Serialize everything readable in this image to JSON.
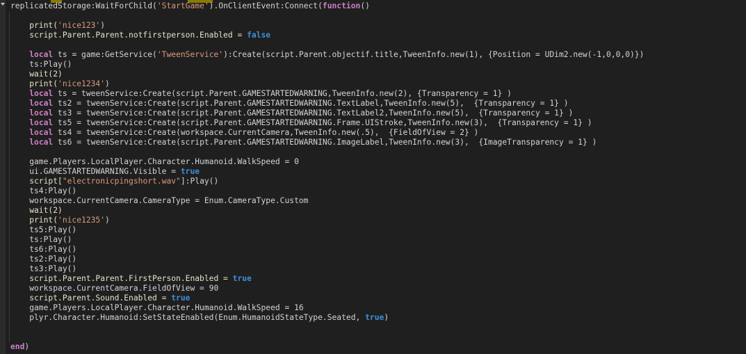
{
  "editor": {
    "colors": {
      "background": "#1f1f1f",
      "keyword": "#cc7fc7",
      "boolean": "#3d8fd6",
      "string": "#d99a7a",
      "text": "#d4d4d4"
    },
    "fold_icon": "chevron-down-icon",
    "lines": [
      [
        [
          "replicatedStorage:WaitForChild(",
          "p"
        ],
        [
          "'StartGame'",
          "s"
        ],
        [
          ").OnClientEvent:Connect(",
          "p"
        ],
        [
          "function",
          "k"
        ],
        [
          "()",
          "p"
        ]
      ],
      [],
      [
        [
          "    print(",
          "g"
        ],
        [
          "'nice123'",
          "s"
        ],
        [
          ")",
          "p"
        ]
      ],
      [
        [
          "    script.Parent.Parent.notfirstperson.Enabled = ",
          "g"
        ],
        [
          "false",
          "b"
        ]
      ],
      [],
      [
        [
          "    ",
          "p"
        ],
        [
          "local",
          "k"
        ],
        [
          " ts = game:GetService(",
          "p"
        ],
        [
          "'TweenService'",
          "s"
        ],
        [
          "):Create(script.Parent.objectif.title,TweenInfo.new(1), {Position = UDim2.new(-1,0,0,0)})",
          "p"
        ]
      ],
      [
        [
          "    ts:Play()",
          "p"
        ]
      ],
      [
        [
          "    wait(2)",
          "g"
        ]
      ],
      [
        [
          "    print(",
          "g"
        ],
        [
          "'nice1234'",
          "s"
        ],
        [
          ")",
          "p"
        ]
      ],
      [
        [
          "    ",
          "p"
        ],
        [
          "local",
          "k"
        ],
        [
          " ts = tweenService:Create(script.Parent.GAMESTARTEDWARNING,TweenInfo.new(2), {Transparency = 1} )",
          "p"
        ]
      ],
      [
        [
          "    ",
          "p"
        ],
        [
          "local",
          "k"
        ],
        [
          " ts2 = tweenService:Create(script.Parent.GAMESTARTEDWARNING.TextLabel,TweenInfo.new(5),  {Transparency = 1} )",
          "p"
        ]
      ],
      [
        [
          "    ",
          "p"
        ],
        [
          "local",
          "k"
        ],
        [
          " ts3 = tweenService:Create(script.Parent.GAMESTARTEDWARNING.TextLabel2,TweenInfo.new(5),  {Transparency = 1} )",
          "p"
        ]
      ],
      [
        [
          "    ",
          "p"
        ],
        [
          "local",
          "k"
        ],
        [
          " ts5 = tweenService:Create(script.Parent.GAMESTARTEDWARNING.Frame.UIStroke,TweenInfo.new(3),  {Transparency = 1} )",
          "p"
        ]
      ],
      [
        [
          "    ",
          "p"
        ],
        [
          "local",
          "k"
        ],
        [
          " ts4 = tweenService:Create(workspace.CurrentCamera,TweenInfo.new(.5),  {FieldOfView = 2} )",
          "p"
        ]
      ],
      [
        [
          "    ",
          "p"
        ],
        [
          "local",
          "k"
        ],
        [
          " ts6 = tweenService:Create(script.Parent.GAMESTARTEDWARNING.ImageLabel,TweenInfo.new(3),  {ImageTransparency = 1} )",
          "p"
        ]
      ],
      [],
      [
        [
          "    game.Players.LocalPlayer.Character.Humanoid.WalkSpeed = 0",
          "p"
        ]
      ],
      [
        [
          "    ui.GAMESTARTEDWARNING.Visible = ",
          "p"
        ],
        [
          "true",
          "b"
        ]
      ],
      [
        [
          "    script[",
          "g"
        ],
        [
          "\"electronicpingshort.wav\"",
          "s"
        ],
        [
          "]:Play()",
          "p"
        ]
      ],
      [
        [
          "    ts4:Play()",
          "p"
        ]
      ],
      [
        [
          "    workspace.CurrentCamera.CameraType = Enum.CameraType.Custom",
          "p"
        ]
      ],
      [
        [
          "    wait(2)",
          "g"
        ]
      ],
      [
        [
          "    print(",
          "g"
        ],
        [
          "'nice1235'",
          "s"
        ],
        [
          ")",
          "p"
        ]
      ],
      [
        [
          "    ts5:Play()",
          "p"
        ]
      ],
      [
        [
          "    ts:Play()",
          "p"
        ]
      ],
      [
        [
          "    ts6:Play()",
          "p"
        ]
      ],
      [
        [
          "    ts2:Play()",
          "p"
        ]
      ],
      [
        [
          "    ts3:Play()",
          "p"
        ]
      ],
      [
        [
          "    script.Parent.Parent.FirstPerson.Enabled = ",
          "g"
        ],
        [
          "true",
          "b"
        ]
      ],
      [
        [
          "    workspace.CurrentCamera.FieldOfView = 90",
          "p"
        ]
      ],
      [
        [
          "    script.Parent.Sound.Enabled = ",
          "g"
        ],
        [
          "true",
          "b"
        ]
      ],
      [
        [
          "    game.Players.LocalPlayer.Character.Humanoid.WalkSpeed = 16",
          "p"
        ]
      ],
      [
        [
          "    plyr.Character.Humanoid:SetStateEnabled(Enum.HumanoidStateType.Seated, ",
          "p"
        ],
        [
          "true",
          "b"
        ],
        [
          ")",
          "p"
        ]
      ],
      [],
      [],
      [
        [
          "end",
          "k"
        ],
        [
          ")",
          "p"
        ]
      ]
    ]
  }
}
